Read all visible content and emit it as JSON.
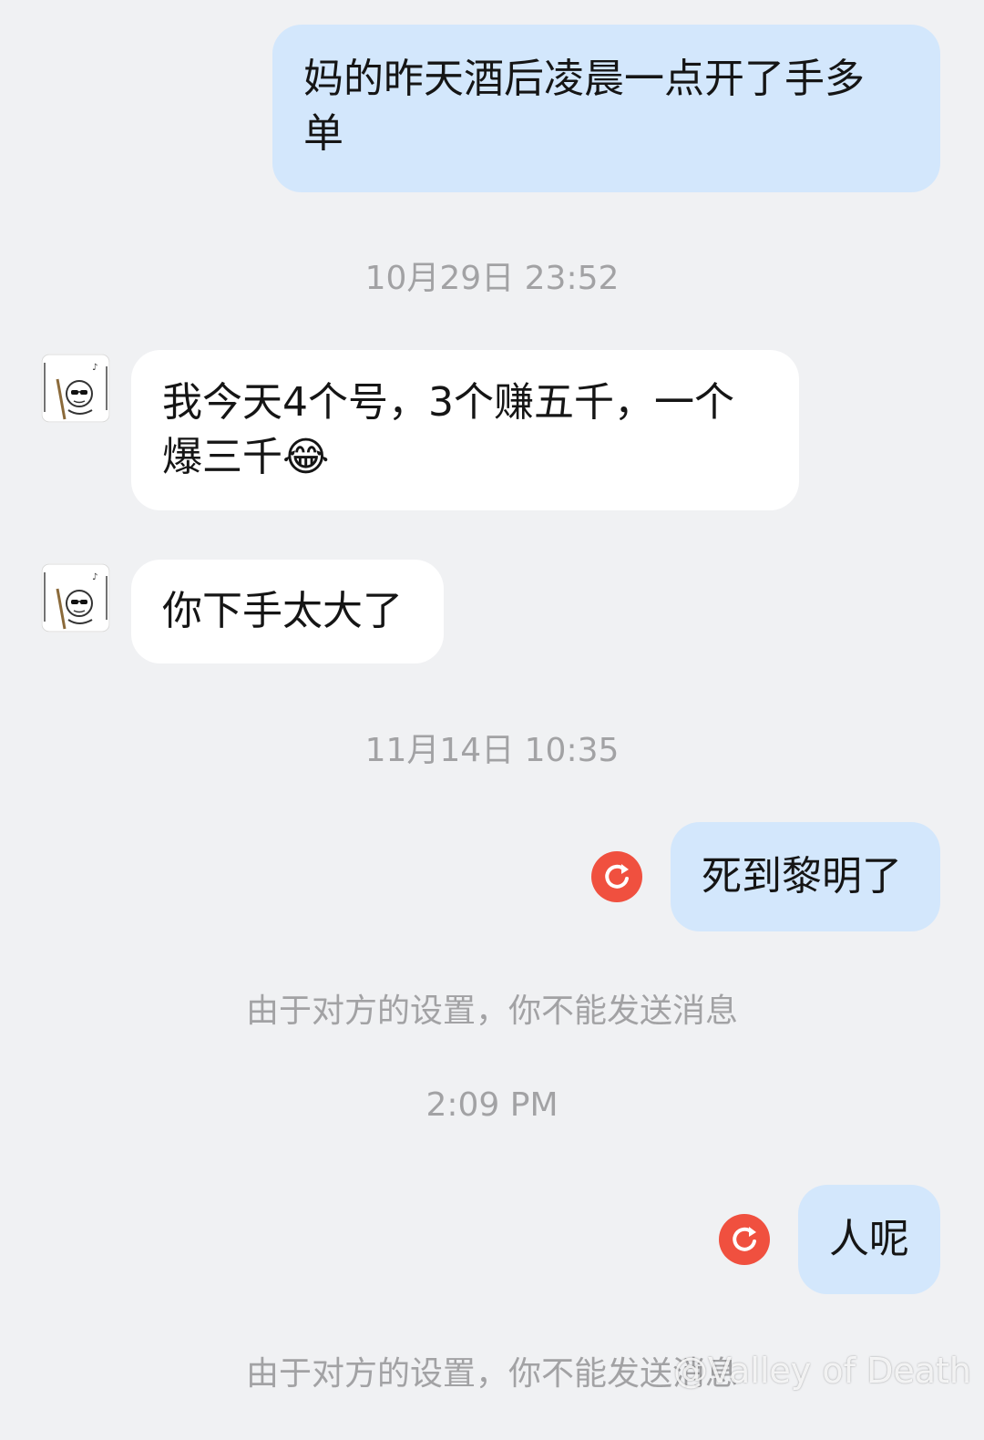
{
  "messages": [
    {
      "text": "妈的昨天酒后凌晨一点开了手多单"
    },
    {
      "text": "我今天4个号，3个赚五千，一个爆三千😂"
    },
    {
      "text": "你下手太大了"
    },
    {
      "text": "死到黎明了"
    },
    {
      "text": "人呢"
    }
  ],
  "timestamps": [
    "10月29日 23:52",
    "11月14日 10:35",
    "2:09 PM"
  ],
  "notices": [
    "由于对方的设置，你不能发送消息",
    "由于对方的设置，你不能发送消息"
  ],
  "watermark": "@Valley of Death",
  "colors": {
    "background": "#f0f1f3",
    "outgoing_bubble": "#d3e7fc",
    "incoming_bubble": "#ffffff",
    "retry_icon": "#f0503f",
    "meta_text": "#a2a2a4"
  },
  "icons": {
    "avatar": "cartoon-avatar-icon",
    "retry": "resend-icon"
  }
}
